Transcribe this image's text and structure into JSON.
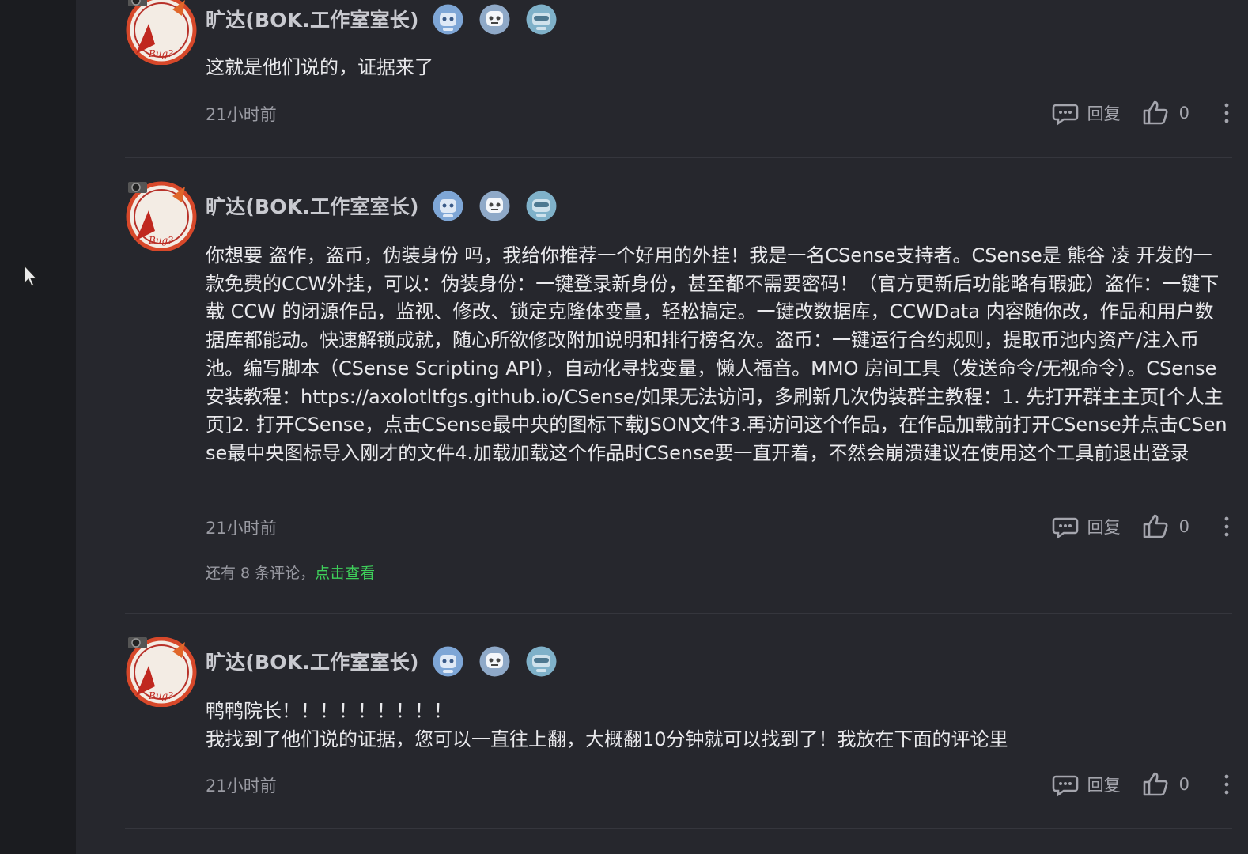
{
  "comments": [
    {
      "author": "旷达(BOK.工作室室长)",
      "content": [
        "这就是他们说的，证据来了"
      ],
      "time": "21小时前",
      "reply_label": "回复",
      "like_count": "0"
    },
    {
      "author": "旷达(BOK.工作室室长)",
      "content": [
        "你想要 盗作，盗币，伪装身份 吗，我给你推荐一个好用的外挂！我是一名CSense支持者。CSense是 熊谷 凌 开发的一款免费的CCW外挂，可以：伪装身份：一键登录新身份，甚至都不需要密码！（官方更新后功能略有瑕疵）盗作：一键下载 CCW 的闭源作品，监视、修改、锁定克隆体变量，轻松搞定。一键改数据库，CCWData 内容随你改，作品和用户数据库都能动。快速解锁成就，随心所欲修改附加说明和排行榜名次。盗币：一键运行合约规则，提取币池内资产/注入币池。编写脚本（CSense Scripting API），自动化寻找变量，懒人福音。MMO 房间工具（发送命令/无视命令）。CSense安装教程：https://axolotltfgs.github.io/CSense/如果无法访问，多刷新几次伪装群主教程：1. 先打开群主主页[个人主页]2. 打开CSense，点击CSense最中央的图标下载JSON文件3.再访问这个作品，在作品加载前打开CSense并点击CSense最中央图标导入刚才的文件4.加载加载这个作品时CSense要一直开着，不然会崩溃建议在使用这个工具前退出登录"
      ],
      "time": "21小时前",
      "reply_label": "回复",
      "like_count": "0",
      "more_replies_text": "还有 8 条评论，",
      "more_replies_link": "点击查看"
    },
    {
      "author": "旷达(BOK.工作室室长)",
      "content": [
        "鸭鸭院长！！！！！！！！！",
        "我找到了他们说的证据，您可以一直往上翻，大概翻10分钟就可以找到了！我放在下面的评论里"
      ],
      "time": "21小时前",
      "reply_label": "回复",
      "like_count": "0"
    }
  ],
  "colors": {
    "background": "#26272d",
    "side_strip": "#1b1c20",
    "link_green": "#3ecf5a",
    "badge_blue": "#8fb6e0"
  },
  "icons": [
    "avatar-illustration",
    "badge-robot-icon",
    "reply-comment-icon",
    "thumbs-up-icon",
    "more-vertical-icon",
    "mouse-cursor-icon"
  ]
}
